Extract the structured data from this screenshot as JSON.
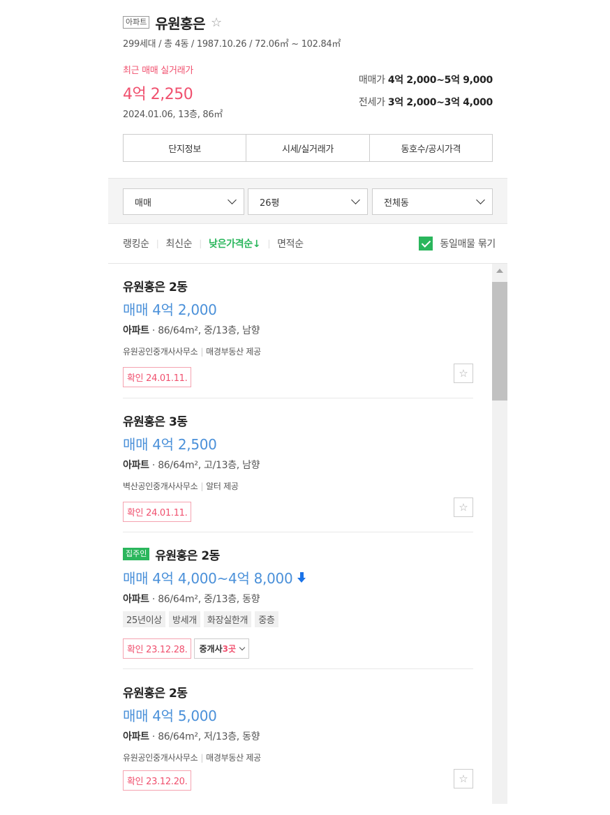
{
  "header": {
    "type_tag": "아파트",
    "name": "유원홍은",
    "star_glyph": "☆",
    "summary": "299세대 / 총 4동 / 1987.10.26 / 72.06㎡ ~ 102.84㎡"
  },
  "recent": {
    "label": "최근 매매 실거래가",
    "price": "4억 2,250",
    "date": "2024.01.06, 13층, 86㎡"
  },
  "ranges": {
    "sale_label": "매매가",
    "sale_value": "4억 2,000~5억 9,000",
    "jeonse_label": "전세가",
    "jeonse_value": "3억 2,000~3억 4,000"
  },
  "tabs": [
    "단지정보",
    "시세/실거래가",
    "동호수/공시가격"
  ],
  "filters": {
    "trade_type": "매매",
    "size": "26평",
    "building": "전체동"
  },
  "sort": {
    "options": [
      "랭킹순",
      "최신순",
      "낮은가격순↓",
      "면적순"
    ],
    "active_index": 2,
    "bundle_label": "동일매물 묶기",
    "bundle_checked": true
  },
  "listings": [
    {
      "badge": "",
      "title": "유원홍은 2동",
      "price": "매매 4억 2,000",
      "spec_type": "아파트",
      "spec_rest": " · 86/64m², 중/13층, 남향",
      "agency": "유원공인중개사사무소",
      "provider": "매경부동산 제공",
      "confirm": "확인 24.01.11.",
      "price_down": false
    },
    {
      "badge": "",
      "title": "유원홍은 3동",
      "price": "매매 4억 2,500",
      "spec_type": "아파트",
      "spec_rest": " · 86/64m², 고/13층, 남향",
      "agency": "벽산공인중개사사무소",
      "provider": "알터 제공",
      "confirm": "확인 24.01.11.",
      "price_down": false
    },
    {
      "badge": "집주인",
      "title": "유원홍은 2동",
      "price": "매매 4억 4,000~4억 8,000",
      "spec_type": "아파트",
      "spec_rest": " · 86/64m², 중/13층, 동향",
      "features": [
        "25년이상",
        "방세개",
        "화장실한개",
        "중층"
      ],
      "confirm": "확인 23.12.28.",
      "broker_label": "중개사 ",
      "broker_count": "3곳",
      "price_down": true
    },
    {
      "badge": "",
      "title": "유원홍은 2동",
      "price": "매매 4억 5,000",
      "spec_type": "아파트",
      "spec_rest": " · 86/64m², 저/13층, 동향",
      "agency": "유원공인중개사사무소",
      "provider": "매경부동산 제공",
      "confirm": "확인 23.12.20.",
      "price_down": false
    }
  ],
  "colors": {
    "accent_green": "#2ab65c",
    "price_blue": "#4a90d9",
    "recent_red": "#f0506e"
  }
}
